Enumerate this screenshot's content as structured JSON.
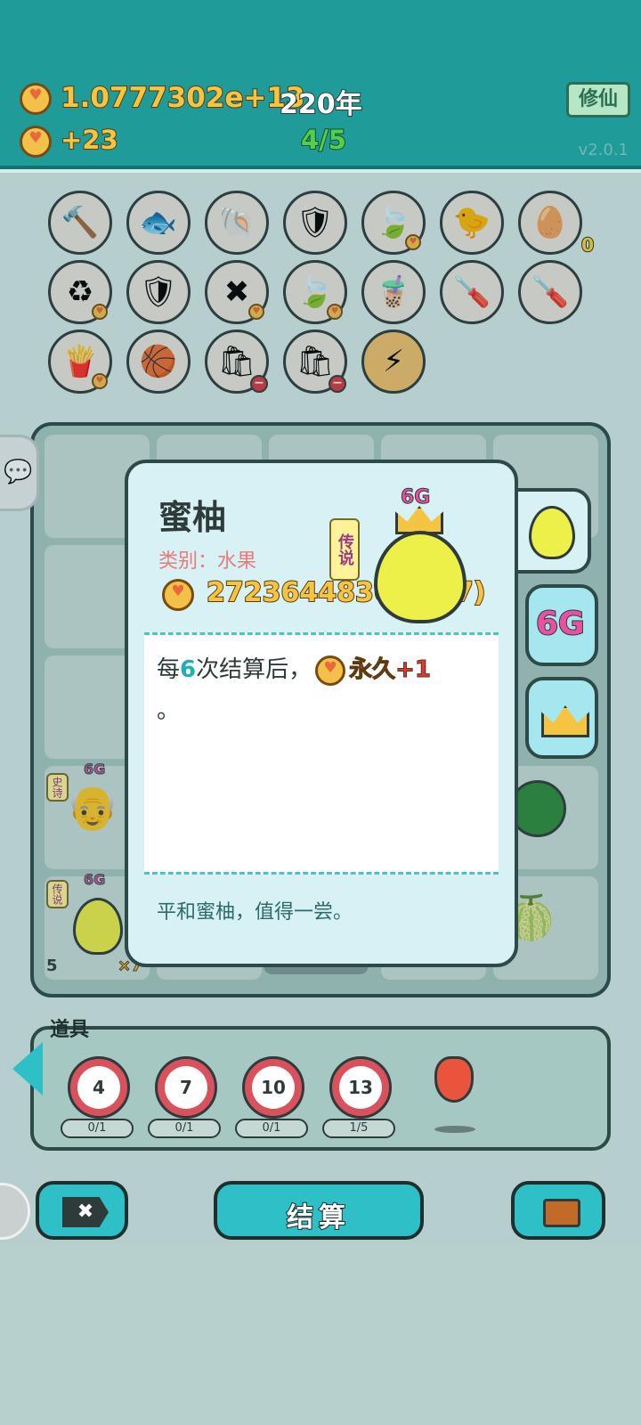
{
  "header": {
    "money": "1.0777302e+13",
    "year": "220年",
    "income": "+23",
    "progress": "4/5",
    "cultivate_label": "修仙",
    "version": "v2.0.1"
  },
  "shelf": {
    "items": [
      {
        "name": "hammer",
        "icon": "🔨"
      },
      {
        "name": "fish-bowl",
        "icon": "🐟"
      },
      {
        "name": "shell",
        "icon": "🐚"
      },
      {
        "name": "shield-wrench",
        "icon": "🛡"
      },
      {
        "name": "leaf",
        "icon": "🍃"
      },
      {
        "name": "chick",
        "icon": "🐤"
      },
      {
        "name": "egg-tray",
        "icon": "🥚",
        "count": "0"
      },
      {
        "name": "recycle",
        "icon": "♻"
      },
      {
        "name": "shield-wrench-2",
        "icon": "🛡"
      },
      {
        "name": "delete-tag",
        "icon": "✖"
      },
      {
        "name": "leaf-2",
        "icon": "🍃"
      },
      {
        "name": "milk-tea",
        "icon": "🧋"
      },
      {
        "name": "screwdriver",
        "icon": "🪛"
      },
      {
        "name": "screwdriver-2",
        "icon": "🪛"
      },
      {
        "name": "fries",
        "icon": "🍟"
      },
      {
        "name": "basketballs",
        "icon": "🏀"
      },
      {
        "name": "trash-bag",
        "icon": "🛍"
      },
      {
        "name": "trash-bag-2",
        "icon": "🛍"
      },
      {
        "name": "lightning",
        "icon": "⚡"
      }
    ]
  },
  "board": {
    "epic_tag": "史诗",
    "legend_tag": "传说",
    "g_label_1": "6G",
    "g_label_2": "6G",
    "count_5": "5",
    "count_x7": "×7"
  },
  "popup": {
    "title": "蜜柚",
    "category": "类别：水果",
    "legend_tag": "传说",
    "g_label": "6G",
    "price": "27236448365 (×7)",
    "desc_prefix": "每",
    "desc_num": "6",
    "desc_mid": "次结算后，",
    "desc_effect": "永久+1",
    "desc_end": "。",
    "flavor": "平和蜜柚，值得一尝。",
    "tab_6g": "6G"
  },
  "tools": {
    "title": "道具",
    "items": [
      {
        "value": "4",
        "progress": "0/1"
      },
      {
        "value": "7",
        "progress": "0/1"
      },
      {
        "value": "10",
        "progress": "0/1"
      },
      {
        "value": "13",
        "progress": "1/5"
      }
    ]
  },
  "buttons": {
    "settle_label": "结算"
  }
}
